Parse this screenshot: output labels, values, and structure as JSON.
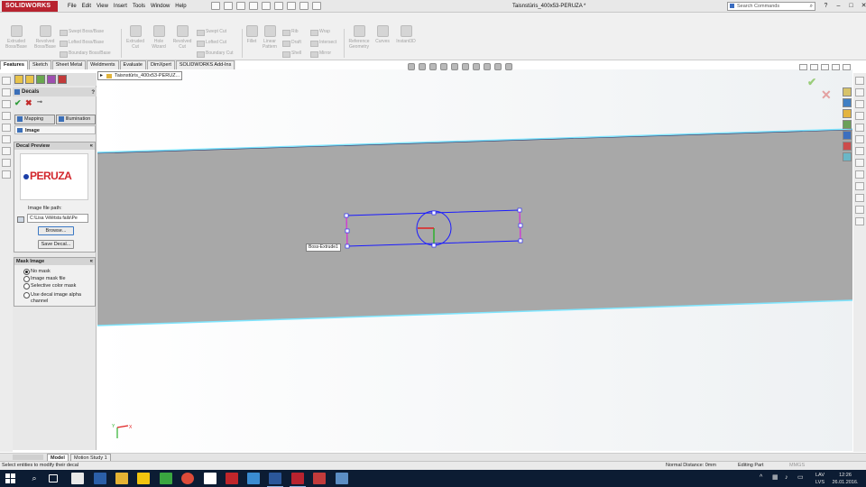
{
  "app": {
    "logo_text": "SOLIDWORKS",
    "menu": [
      "File",
      "Edit",
      "View",
      "Insert",
      "Tools",
      "Window",
      "Help"
    ],
    "document_title": "Taisnstūris_400x53-PERUZA *",
    "search_placeholder": "Search Commands",
    "window_buttons": [
      "?",
      "–",
      "□",
      "✕"
    ]
  },
  "ribbon": {
    "large_buttons": [
      {
        "label1": "Extruded",
        "label2": "Boss/Base"
      },
      {
        "label1": "Revolved",
        "label2": "Boss/Base"
      },
      {
        "label1": "Extruded",
        "label2": "Cut"
      },
      {
        "label1": "Hole",
        "label2": "Wizard"
      },
      {
        "label1": "Revolved",
        "label2": "Cut"
      },
      {
        "label1": "Fillet",
        "label2": ""
      },
      {
        "label1": "Linear",
        "label2": "Pattern"
      },
      {
        "label1": "Reference",
        "label2": "Geometry"
      },
      {
        "label1": "Curves",
        "label2": ""
      },
      {
        "label1": "Instant3D",
        "label2": ""
      }
    ],
    "small_buttons": {
      "swept_boss": "Swept Boss/Base",
      "lofted_boss": "Lofted Boss/Base",
      "boundary_boss": "Boundary Boss/Base",
      "swept_cut": "Swept Cut",
      "lofted_cut": "Lofted Cut",
      "boundary_cut": "Boundary Cut",
      "rib": "Rib",
      "draft": "Draft",
      "shell": "Shell",
      "wrap": "Wrap",
      "intersect": "Intersect",
      "mirror": "Mirror"
    }
  },
  "command_tabs": [
    "Features",
    "Sketch",
    "Sheet Metal",
    "Weldments",
    "Evaluate",
    "DimXpert",
    "SOLIDWORKS Add-Ins"
  ],
  "feature_tree_flyout": "Taisnstūris_400x53-PERUZ...",
  "property_manager": {
    "title": "Decals",
    "help": "?",
    "ok_icon": "✔",
    "cancel_icon": "✖",
    "pin_icon": "⊸",
    "tabs": [
      "Mapping",
      "Illumination"
    ],
    "image_tab": "Image",
    "decal_preview": {
      "header": "Decal Preview",
      "logo_text": "PERUZA",
      "path_label": "Image file path:",
      "path_value": "C:\\Lisa Vēlētsta fails\\Pe",
      "browse_label": "Browse...",
      "save_label": "Save Decal..."
    },
    "mask_image": {
      "header": "Mask Image",
      "options": [
        "No mask",
        "Image mask file",
        "Selective color mask"
      ],
      "selected": "No mask",
      "alpha_label_1": "Use decal image alpha",
      "alpha_label_2": "channel"
    }
  },
  "viewport": {
    "tooltip": "Boss-Extrude1",
    "triad_x": "X",
    "triad_y": "Y"
  },
  "bottom_tabs": [
    "Model",
    "Motion Study 1"
  ],
  "status": {
    "message": "Select entities to modify their decal",
    "normal_distance": "Normal Distance: 0mm",
    "mode": "Editing Part",
    "units": "MMGS"
  },
  "taskbar": {
    "lang_1": "LAV",
    "lang_2": "LVS",
    "time": "12:26",
    "date": "26.01.2016."
  },
  "colors": {
    "part_body": "#a8a8a8",
    "sketch_line": "#1a1aff",
    "edge_highlight": "#7fe6ff",
    "accent_red": "#b8232f"
  }
}
